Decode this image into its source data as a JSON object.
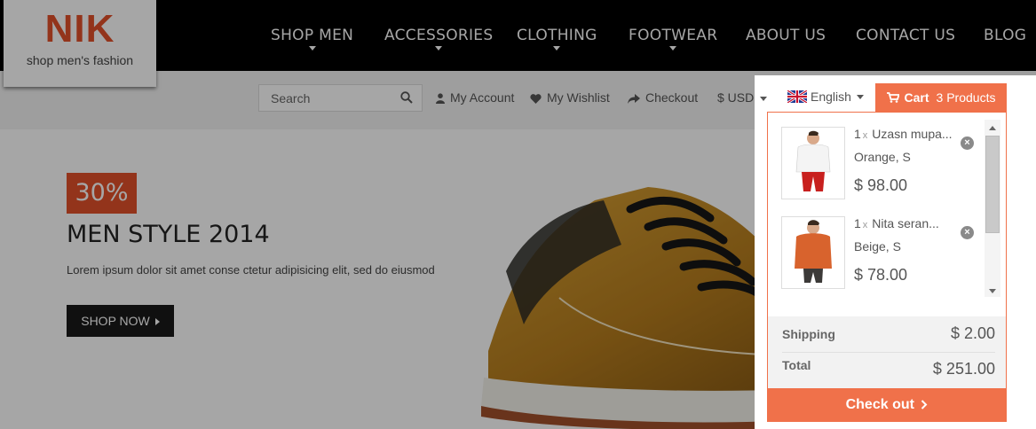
{
  "brand": {
    "logo": "NIK",
    "tagline": "shop men's fashion",
    "color": "#e2502a"
  },
  "nav": {
    "items": [
      {
        "label": "SHOP MEN",
        "has_caret": true
      },
      {
        "label": "ACCESSORIES",
        "has_caret": true
      },
      {
        "label": "CLOTHING",
        "has_caret": true
      },
      {
        "label": "FOOTWEAR",
        "has_caret": true
      },
      {
        "label": "ABOUT US",
        "has_caret": false
      },
      {
        "label": "CONTACT US",
        "has_caret": false
      },
      {
        "label": "BLOG",
        "has_caret": false
      }
    ]
  },
  "utility": {
    "search_placeholder": "Search",
    "my_account": "My Account",
    "my_wishlist": "My Wishlist",
    "checkout": "Checkout",
    "currency": "$ USD",
    "language": "English"
  },
  "cart": {
    "title": "Cart",
    "count_label": "3 Products",
    "accent": "#f0714a",
    "items": [
      {
        "qty": "1",
        "name": "Uzasn mupa...",
        "variant": "Orange, S",
        "price": "$ 98.00",
        "thumb": "white-shirt-model"
      },
      {
        "qty": "1",
        "name": "Nita seran...",
        "variant": "Beige, S",
        "price": "$ 78.00",
        "thumb": "orange-jacket-model"
      }
    ],
    "shipping_label": "Shipping",
    "shipping_value": "$ 2.00",
    "total_label": "Total",
    "total_value": "$ 251.00",
    "checkout_label": "Check out"
  },
  "hero": {
    "badge": "30%",
    "title": "MEN STYLE 2014",
    "subtitle": "Lorem ipsum dolor sit amet conse ctetur adipisicing elit, sed do eiusmod",
    "button": "SHOP NOW"
  }
}
